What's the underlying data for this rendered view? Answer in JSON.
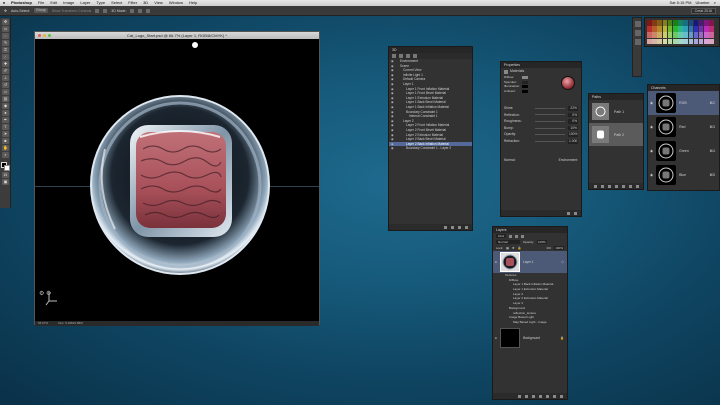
{
  "menubar": {
    "apple": "",
    "items": [
      "Photoshop",
      "File",
      "Edit",
      "Image",
      "Layer",
      "Type",
      "Select",
      "Filter",
      "3D",
      "View",
      "Window",
      "Help"
    ],
    "clock": "Sat 5:15 PM",
    "user": "Ubarker"
  },
  "options": {
    "tool_value": "Auto-Select:",
    "layer_select": "Group",
    "transform_label": "Show Transform Controls",
    "mode_label": "3D Mode:",
    "workspace": "Creat 2016"
  },
  "document": {
    "title": "Cat_Logo_Start.psd @ 66.7% (Layer 1, RGB/8/CMYK) *",
    "status_zoom": "66.67%",
    "status_doc": "Doc: 5.49M/4.68M"
  },
  "scene_panel": {
    "title": "3D",
    "items": [
      {
        "label": "Environment",
        "indent": 1,
        "selected": false
      },
      {
        "label": "Scene",
        "indent": 1,
        "selected": false
      },
      {
        "label": "Current View",
        "indent": 2,
        "selected": false
      },
      {
        "label": "Infinite Light 1",
        "indent": 2,
        "selected": false
      },
      {
        "label": "Default Camera",
        "indent": 2,
        "selected": false
      },
      {
        "label": "Layer 1",
        "indent": 2,
        "selected": false
      },
      {
        "label": "Layer 1 Front Inflation Material",
        "indent": 3,
        "selected": false
      },
      {
        "label": "Layer 1 Front Bevel Material",
        "indent": 3,
        "selected": false
      },
      {
        "label": "Layer 1 Extrusion Material",
        "indent": 3,
        "selected": false
      },
      {
        "label": "Layer 1 Back Bevel Material",
        "indent": 3,
        "selected": false
      },
      {
        "label": "Layer 1 Back Inflation Material",
        "indent": 3,
        "selected": false
      },
      {
        "label": "Boundary Constraint 1",
        "indent": 3,
        "selected": false
      },
      {
        "label": "Internal Constraint 1",
        "indent": 4,
        "selected": false
      },
      {
        "label": "Layer 2",
        "indent": 2,
        "selected": false
      },
      {
        "label": "Layer 2 Front Inflation Material",
        "indent": 3,
        "selected": false
      },
      {
        "label": "Layer 2 Front Bevel Material",
        "indent": 3,
        "selected": false
      },
      {
        "label": "Layer 2 Extrusion Material",
        "indent": 3,
        "selected": false
      },
      {
        "label": "Layer 2 Back Bevel Material",
        "indent": 3,
        "selected": false
      },
      {
        "label": "Layer 2 Back Inflation Material",
        "indent": 3,
        "selected": true
      },
      {
        "label": "Boundary Constraint 1 - Layer 2",
        "indent": 3,
        "selected": false
      }
    ]
  },
  "properties_panel": {
    "title": "Properties",
    "section": "Materials",
    "swatch_rows": [
      "Diffuse:",
      "Specular:",
      "Illumination:",
      "Ambient:"
    ],
    "sliders": [
      {
        "label": "Shine:",
        "value": "22%"
      },
      {
        "label": "Reflection:",
        "value": "0%"
      },
      {
        "label": "Roughness:",
        "value": "0%"
      },
      {
        "label": "Bump:",
        "value": "10%"
      },
      {
        "label": "Opacity:",
        "value": "100%"
      },
      {
        "label": "Refraction:",
        "value": "1.000"
      }
    ],
    "normal_label": "Normal:",
    "environment_label": "Environment:"
  },
  "paths_panel": {
    "title": "Paths",
    "items": [
      {
        "label": "Path 1",
        "selected": false
      },
      {
        "label": "Path 2",
        "selected": true
      }
    ]
  },
  "channels_panel": {
    "title": "Channels",
    "items": [
      {
        "label": "RGB",
        "key": "⌘2",
        "selected": true
      },
      {
        "label": "Red",
        "key": "⌘3",
        "selected": false
      },
      {
        "label": "Green",
        "key": "⌘4",
        "selected": false
      },
      {
        "label": "Blue",
        "key": "⌘5",
        "selected": false
      }
    ]
  },
  "layers_panel": {
    "title": "Layers",
    "kind_label": "Kind",
    "blend_mode": "Normal",
    "opacity_label": "Opacity:",
    "opacity_value": "100%",
    "lock_label": "Lock:",
    "fill_label": "Fill:",
    "fill_value": "100%",
    "layer1_name": "Layer 1",
    "sub_items": [
      {
        "label": "Textures",
        "indent": 1
      },
      {
        "label": "Diffuse",
        "indent": 2
      },
      {
        "label": "Layer 1 Back Inflation Material",
        "indent": 3
      },
      {
        "label": "Layer 1 Extrusion Material",
        "indent": 3
      },
      {
        "label": "Layer 2",
        "indent": 3
      },
      {
        "label": "Layer 2 Extrusion Material",
        "indent": 3
      },
      {
        "label": "Layer 2",
        "indent": 3
      },
      {
        "label": "Background",
        "indent": 2
      },
      {
        "label": "reflection_texture",
        "indent": 3
      },
      {
        "label": "Image Based Light",
        "indent": 2
      },
      {
        "label": "Map Based Light - Image",
        "indent": 3
      }
    ],
    "background_name": "Background"
  },
  "colors": {
    "desktop": "#175b7c",
    "selection": "#536a9a",
    "cushion": "#a8505a"
  }
}
